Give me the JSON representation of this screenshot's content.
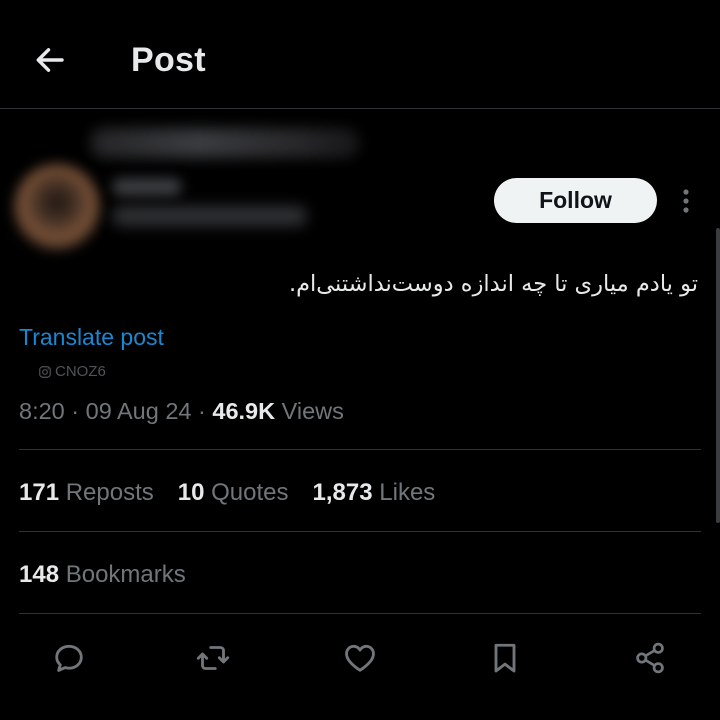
{
  "header": {
    "title": "Post",
    "back_icon": "arrow-left-icon"
  },
  "author": {
    "follow_label": "Follow",
    "more_icon": "more-vertical-icon"
  },
  "post": {
    "text": "تو یادم میاری تا چه اندازه دوست‌نداشتنی‌ام.",
    "translate_label": "Translate post",
    "watermark": "CNOZ6",
    "time": "8:20",
    "date": "09 Aug 24",
    "views_count": "46.9K",
    "views_label": "Views"
  },
  "stats": {
    "reposts_count": "171",
    "reposts_label": "Reposts",
    "quotes_count": "10",
    "quotes_label": "Quotes",
    "likes_count": "1,873",
    "likes_label": "Likes",
    "bookmarks_count": "148",
    "bookmarks_label": "Bookmarks"
  },
  "actions": {
    "reply_icon": "reply-icon",
    "repost_icon": "repost-icon",
    "like_icon": "heart-icon",
    "bookmark_icon": "bookmark-icon",
    "share_icon": "share-icon"
  },
  "colors": {
    "background": "#000000",
    "text_primary": "#e7e9ea",
    "text_secondary": "#71767b",
    "link": "#1d9bf0",
    "divider": "#2f3336",
    "button_bg": "#eff3f4"
  }
}
